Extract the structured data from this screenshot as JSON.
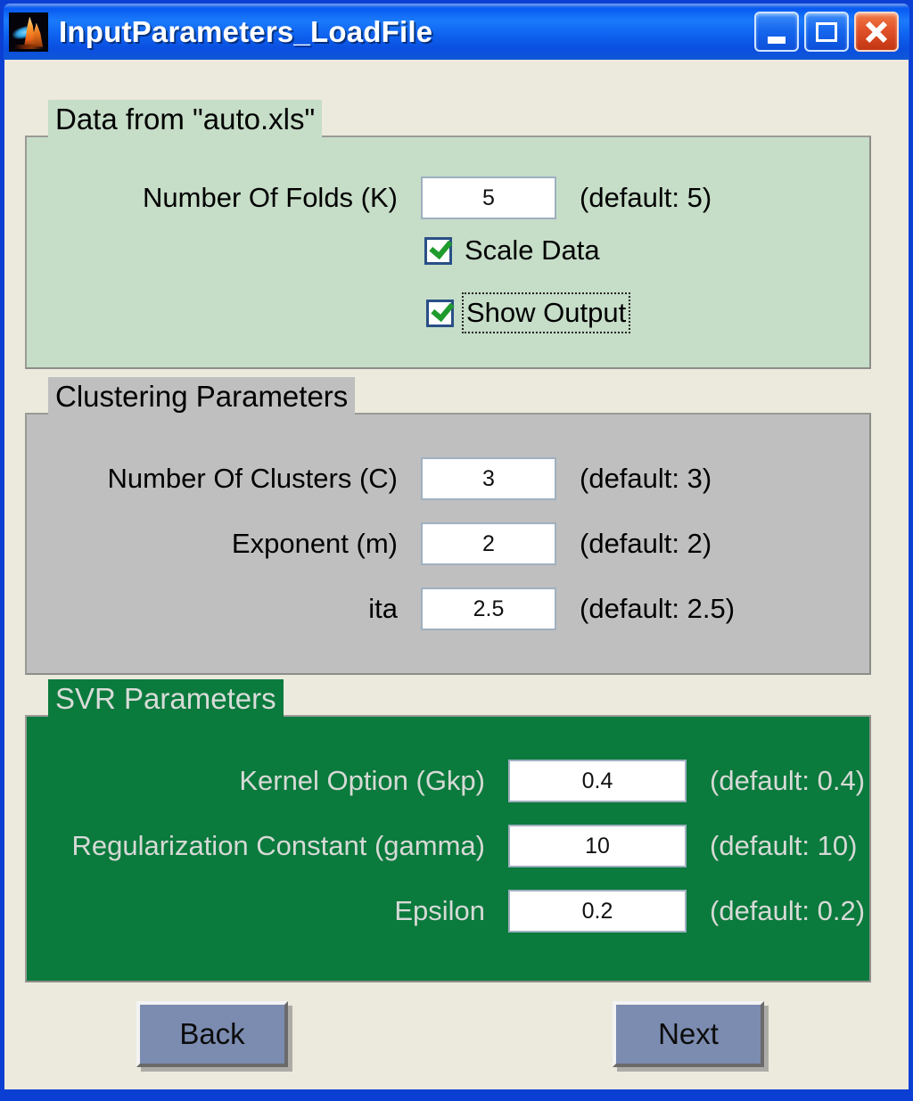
{
  "window": {
    "title": "InputParameters_LoadFile",
    "icon": "matlab-membrane-icon",
    "controls": [
      {
        "name": "minimize",
        "glyph": "_"
      },
      {
        "name": "maximize",
        "glyph": "□"
      },
      {
        "name": "close",
        "glyph": "X"
      }
    ],
    "colors": {
      "titlebar": "#0f63f0",
      "client_background": "#ece9dd",
      "panel_data": "#c6ddc8",
      "panel_cluster": "#bfbfbf",
      "panel_svr": "#0b7a3d",
      "button": "#7b8cb0",
      "checkbox_border": "#2a4f86",
      "check_tick": "#1f9b2e"
    }
  },
  "panels": {
    "data": {
      "title": "Data from \"auto.xls\"",
      "rows": [
        {
          "label": "Number Of Folds (K)",
          "value": "5",
          "default": "(default: 5)"
        }
      ],
      "checkboxes": [
        {
          "label": "Scale Data",
          "checked": true,
          "focused": false
        },
        {
          "label": "Show Output",
          "checked": true,
          "focused": true
        }
      ]
    },
    "clustering": {
      "title": "Clustering Parameters",
      "rows": [
        {
          "label": "Number Of Clusters (C)",
          "value": "3",
          "default": "(default: 3)"
        },
        {
          "label": "Exponent (m)",
          "value": "2",
          "default": "(default: 2)"
        },
        {
          "label": "ita",
          "value": "2.5",
          "default": "(default: 2.5)"
        }
      ]
    },
    "svr": {
      "title": "SVR Parameters",
      "rows": [
        {
          "label": "Kernel Option (Gkp)",
          "value": "0.4",
          "default": "(default: 0.4)"
        },
        {
          "label": "Regularization Constant (gamma)",
          "value": "10",
          "default": "(default: 10)"
        },
        {
          "label": "Epsilon",
          "value": "0.2",
          "default": "(default: 0.2)"
        }
      ]
    }
  },
  "footer": {
    "back_label": "Back",
    "next_label": "Next"
  }
}
